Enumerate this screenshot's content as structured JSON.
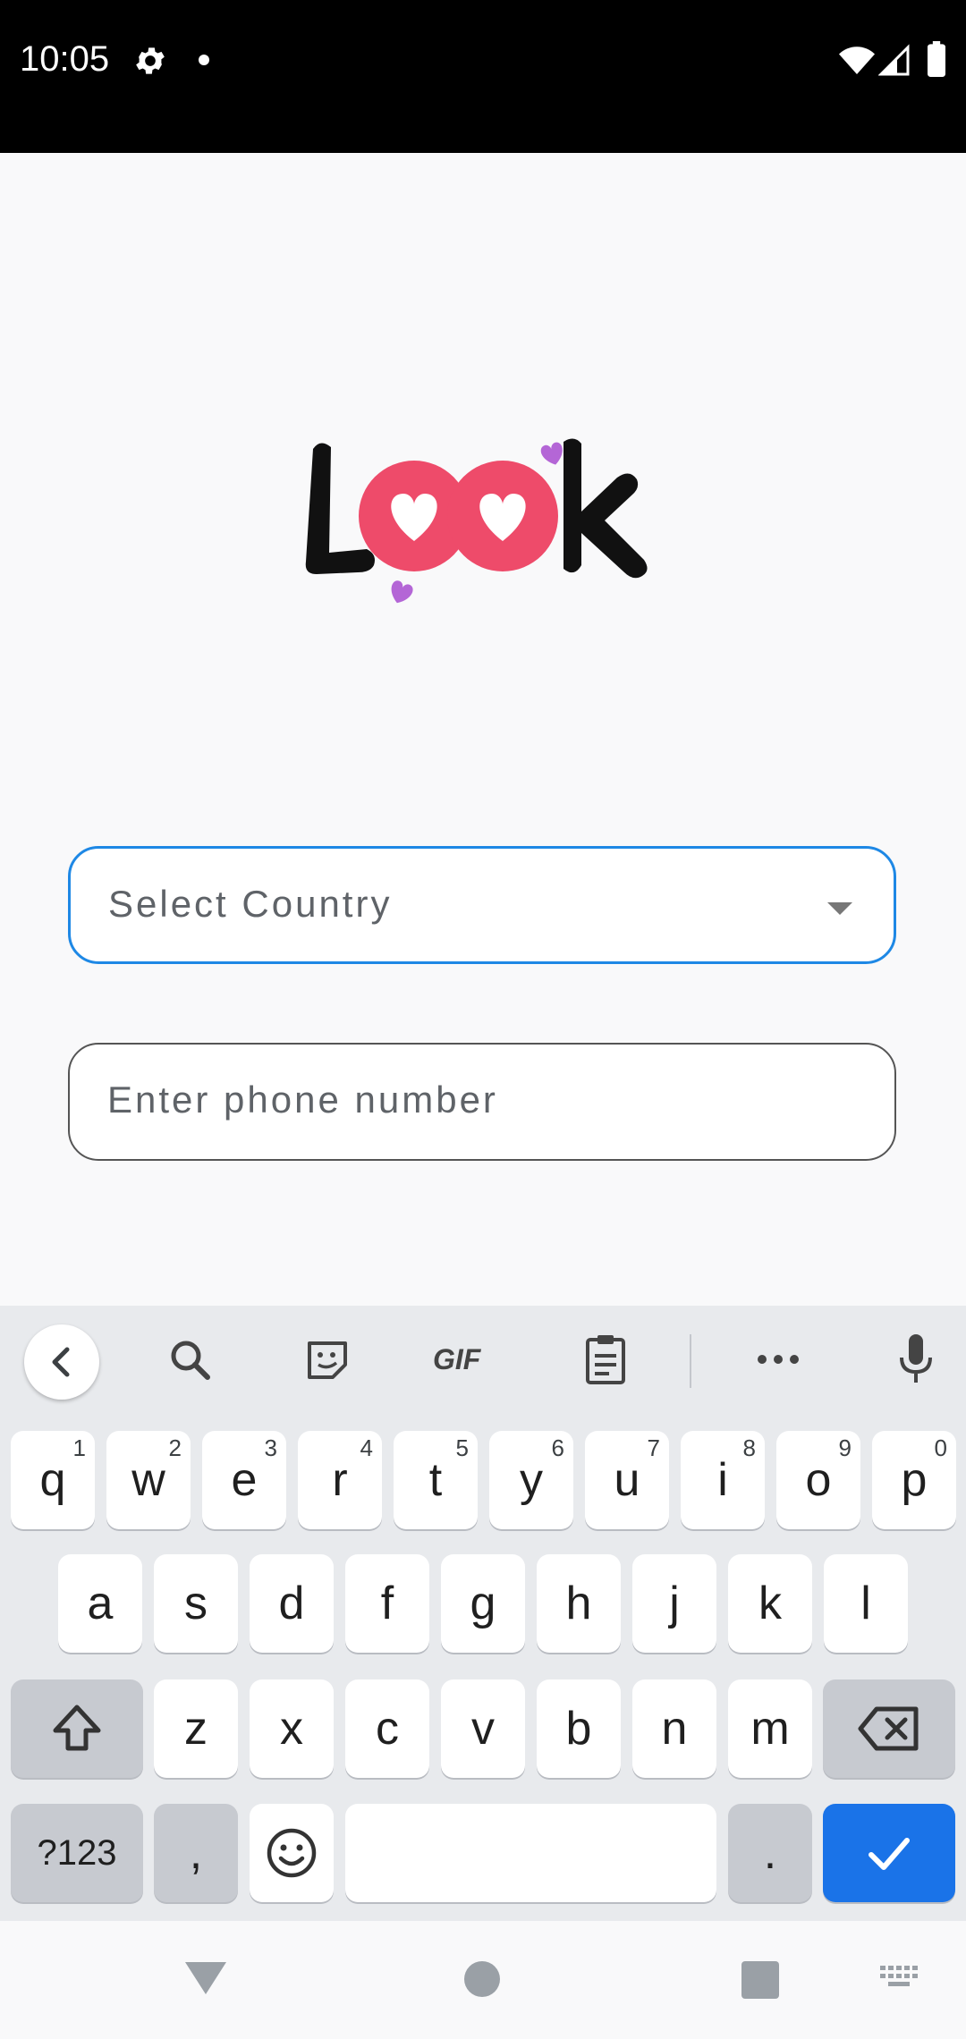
{
  "status_bar": {
    "time": "10:05",
    "icons": [
      "gear-icon",
      "notification-dot-icon",
      "wifi-icon",
      "cell-signal-icon",
      "battery-icon"
    ]
  },
  "logo": {
    "text": "Look"
  },
  "form": {
    "country_placeholder": "Select Country",
    "phone_placeholder": "Enter phone number"
  },
  "keyboard": {
    "toolbar": [
      "back-icon",
      "search-icon",
      "sticker-icon",
      "gif-icon",
      "clipboard-icon",
      "more-icon",
      "microphone-icon"
    ],
    "gif_label": "GIF",
    "row1": [
      {
        "k": "q",
        "n": "1"
      },
      {
        "k": "w",
        "n": "2"
      },
      {
        "k": "e",
        "n": "3"
      },
      {
        "k": "r",
        "n": "4"
      },
      {
        "k": "t",
        "n": "5"
      },
      {
        "k": "y",
        "n": "6"
      },
      {
        "k": "u",
        "n": "7"
      },
      {
        "k": "i",
        "n": "8"
      },
      {
        "k": "o",
        "n": "9"
      },
      {
        "k": "p",
        "n": "0"
      }
    ],
    "row2": [
      "a",
      "s",
      "d",
      "f",
      "g",
      "h",
      "j",
      "k",
      "l"
    ],
    "row3": [
      "z",
      "x",
      "c",
      "v",
      "b",
      "n",
      "m"
    ],
    "symbols_label": "?123",
    "comma_label": ",",
    "period_label": "."
  },
  "colors": {
    "accent": "#1a73e8",
    "focus_border": "#1e88e5",
    "logo_pink": "#ee4b6a"
  }
}
